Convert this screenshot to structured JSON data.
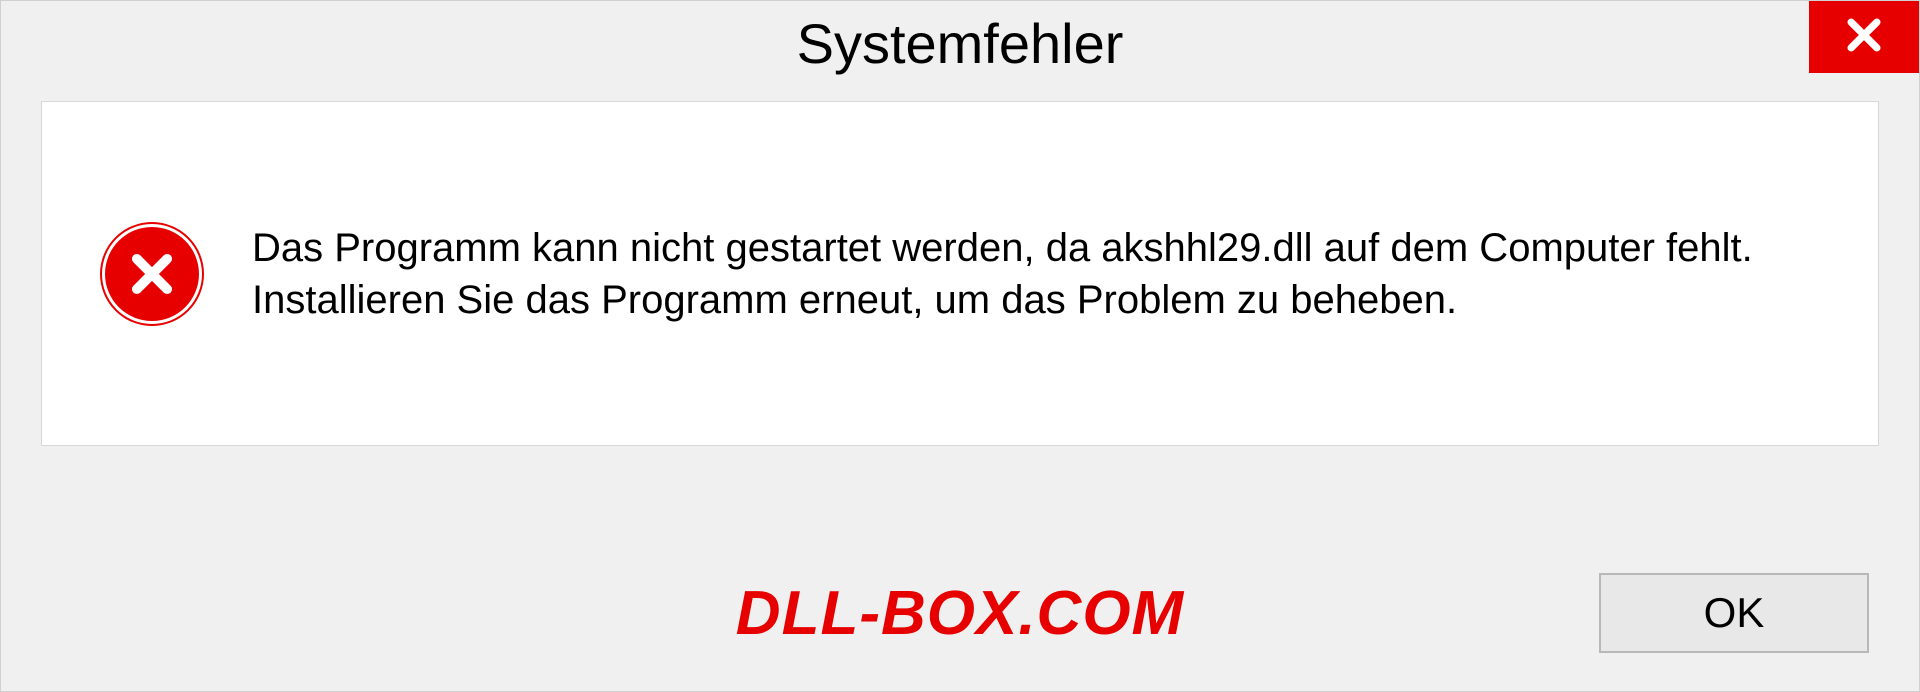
{
  "dialog": {
    "title": "Systemfehler",
    "message": "Das Programm kann nicht gestartet werden, da akshhl29.dll auf dem Computer fehlt. Installieren Sie das Programm erneut, um das Problem zu beheben.",
    "ok_label": "OK"
  },
  "watermark": "DLL-BOX.COM"
}
